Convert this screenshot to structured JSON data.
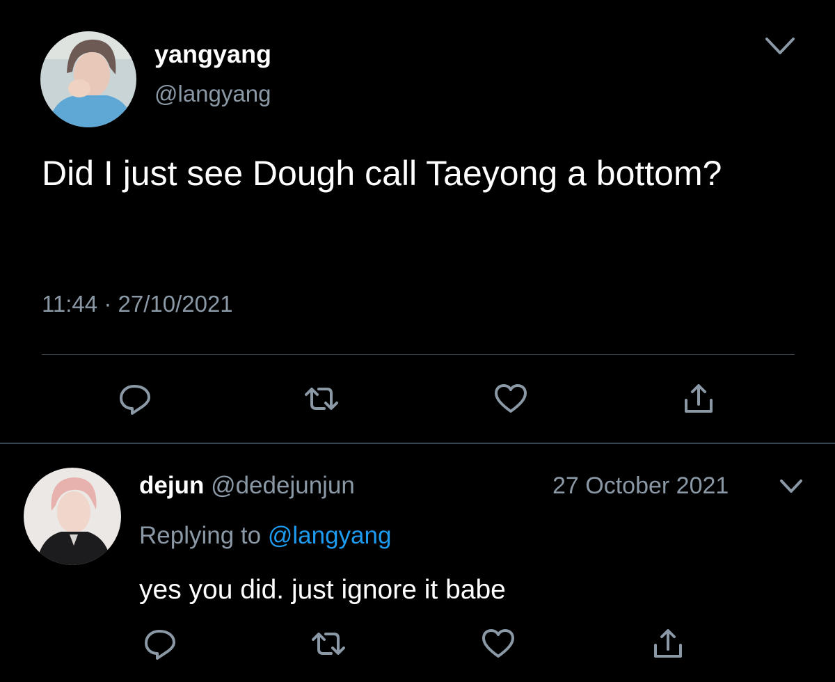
{
  "colors": {
    "background": "#000000",
    "text_primary": "#ffffff",
    "text_secondary": "#8b98a5",
    "link": "#1d9bf0",
    "divider": "#38444d"
  },
  "main_tweet": {
    "display_name": "yangyang",
    "handle": "@langyang",
    "text": "Did I just see Dough call Taeyong a bottom?",
    "time": "11:44",
    "separator": "·",
    "date": "27/10/2021",
    "actions": [
      "reply-icon",
      "retweet-icon",
      "like-icon",
      "share-icon"
    ]
  },
  "reply_tweet": {
    "display_name": "dejun",
    "handle": "@dedejunjun",
    "date": "27 October 2021",
    "replying_to_label": "Replying to",
    "replying_to_handle": "@langyang",
    "text": "yes you did. just ignore it babe",
    "actions": [
      "reply-icon",
      "retweet-icon",
      "like-icon",
      "share-icon"
    ]
  }
}
